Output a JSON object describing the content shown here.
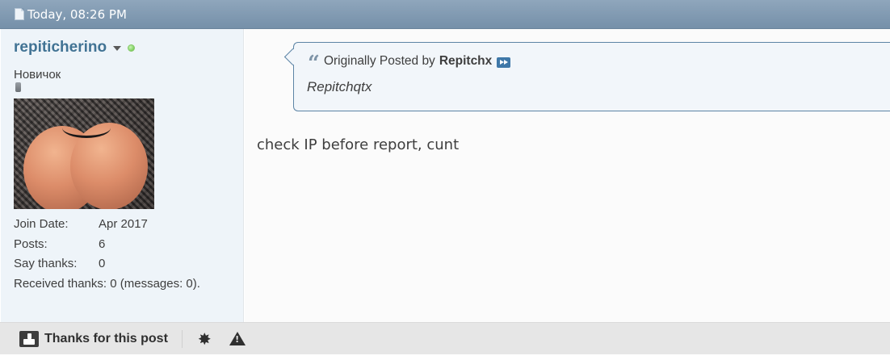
{
  "header": {
    "date": "Today, 08:26 PM"
  },
  "user": {
    "name": "repiticherino",
    "title": "Новичок",
    "stats": [
      {
        "label": "Join Date:",
        "value": "Apr 2017"
      },
      {
        "label": "Posts:",
        "value": "6"
      },
      {
        "label": "Say thanks:",
        "value": "0"
      }
    ],
    "received_thanks": "Received thanks: 0 (messages: 0)."
  },
  "quote": {
    "prefix": "Originally Posted by",
    "author": "Repitchx",
    "text": "Repitchqtx"
  },
  "message": "check IP before report, cunt",
  "footer": {
    "thanks_label": "Thanks for this post"
  },
  "colors": {
    "header_bar": "#8199b0",
    "username": "#417394",
    "quote_border": "#5c84a5",
    "online": "#5fbf3c"
  }
}
